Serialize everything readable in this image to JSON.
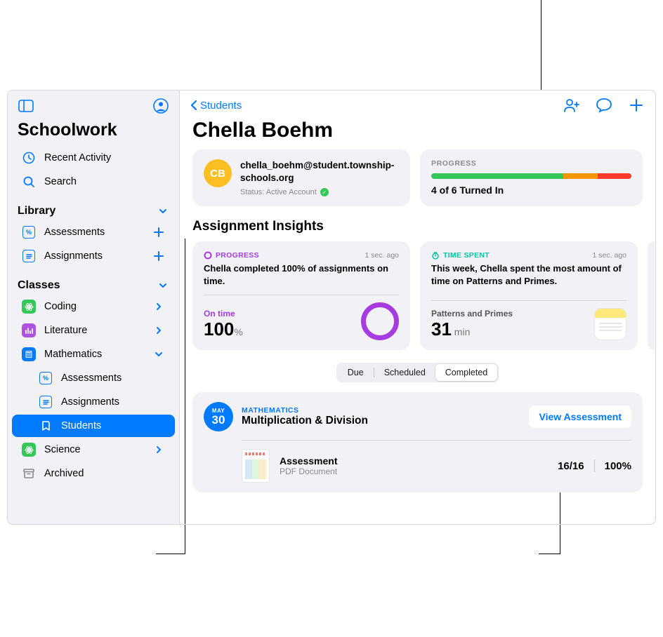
{
  "sidebar": {
    "app_title": "Schoolwork",
    "recent": "Recent Activity",
    "search": "Search",
    "library": {
      "title": "Library",
      "items": [
        {
          "label": "Assessments"
        },
        {
          "label": "Assignments"
        }
      ]
    },
    "classes": {
      "title": "Classes",
      "items": [
        {
          "label": "Coding",
          "color": "#34c759",
          "glyph": "✱"
        },
        {
          "label": "Literature",
          "color": "#af52de",
          "glyph": "|ıl|"
        },
        {
          "label": "Mathematics",
          "color": "#007aff",
          "glyph": "⌂"
        },
        {
          "label": "Science",
          "color": "#34c759",
          "glyph": "✱"
        }
      ],
      "math_children": [
        {
          "label": "Assessments"
        },
        {
          "label": "Assignments"
        },
        {
          "label": "Students"
        }
      ]
    },
    "archived": "Archived"
  },
  "header": {
    "back": "Students",
    "title": "Chella Boehm"
  },
  "student": {
    "initials": "CB",
    "email": "chella_boehm@student.township-schools.org",
    "status_label": "Status: Active Account"
  },
  "progress": {
    "label": "PROGRESS",
    "text": "4 of 6 Turned In",
    "segments": [
      {
        "color": "#34c759",
        "pct": 66
      },
      {
        "color": "#ff9500",
        "pct": 17
      },
      {
        "color": "#ff3b30",
        "pct": 17
      }
    ]
  },
  "insights_heading": "Assignment Insights",
  "insights": [
    {
      "tag": "PROGRESS",
      "tag_color": "#a63be0",
      "time": "1 sec. ago",
      "message": "Chella completed 100% of assignments on time.",
      "metric_label": "On time",
      "metric_value": "100",
      "metric_unit": "%",
      "visual": "ring"
    },
    {
      "tag": "TIME SPENT",
      "tag_color": "#00c7a3",
      "time": "1 sec. ago",
      "message": "This week, Chella spent the most amount of time on Patterns and Primes.",
      "metric_label": "Patterns and Primes",
      "metric_value": "31",
      "metric_unit": " min",
      "visual": "notes"
    }
  ],
  "segmented": {
    "items": [
      "Due",
      "Scheduled",
      "Completed"
    ],
    "active": 2
  },
  "assignment": {
    "month": "MAY",
    "day": "30",
    "subject": "MATHEMATICS",
    "title": "Multiplication & Division",
    "button": "View Assessment",
    "item": {
      "name": "Assessment",
      "type": "PDF Document",
      "score": "16/16",
      "percent": "100%"
    }
  }
}
